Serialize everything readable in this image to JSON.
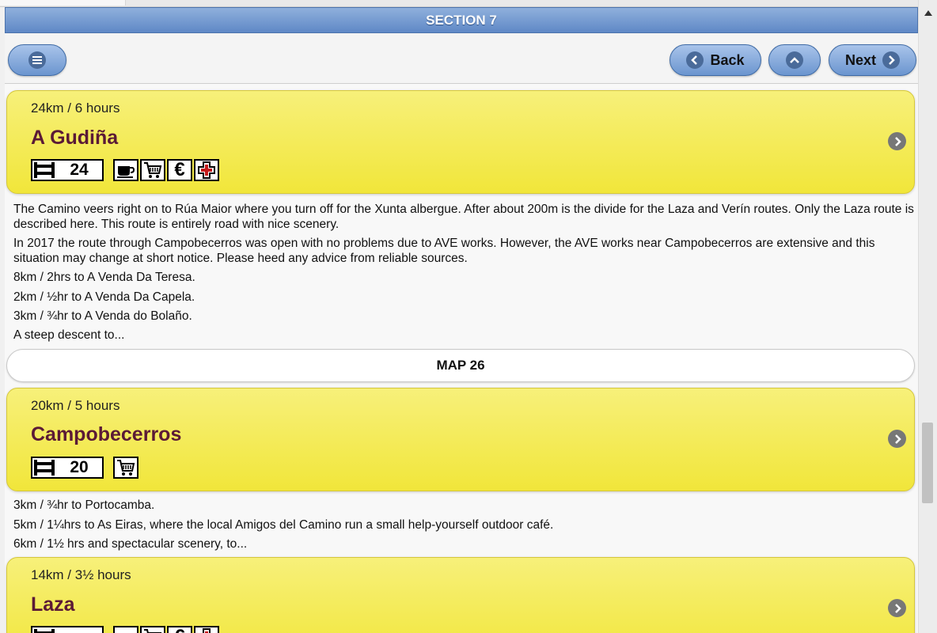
{
  "header": {
    "title": "SECTION 7"
  },
  "toolbar": {
    "back_label": "Back",
    "next_label": "Next"
  },
  "stages": [
    {
      "distance": "24km / 6 hours",
      "place": "A Gudiña",
      "beds": "24",
      "facilities": [
        "cafe-icon",
        "shop-cart-icon",
        "euro-icon",
        "medical-cross-icon"
      ]
    },
    {
      "distance": "20km / 5 hours",
      "place": "Campobecerros",
      "beds": "20",
      "facilities": [
        "shop-cart-icon"
      ]
    },
    {
      "distance": "14km / 3½ hours",
      "place": "Laza",
      "beds": "",
      "facilities": [
        "cafe-icon",
        "shop-cart-icon",
        "euro-icon",
        "medical-cross-icon"
      ]
    }
  ],
  "paragraphs1": [
    "The Camino veers right on to Rúa Maior where you turn off for the Xunta albergue. After about 200m is the divide for the Laza and Verín routes. Only the Laza route is described here. This route is entirely road with nice scenery.",
    "In 2017 the route through Campobecerros was open with no problems due to AVE works. However, the AVE works near Campobecerros are extensive and this situation may change at short notice. Please heed any advice from reliable sources.",
    "8km / 2hrs to A Venda Da Teresa.",
    "2km / ½hr to A Venda Da Capela.",
    "3km / ¾hr to A Venda do Bolaño.",
    "A steep descent to..."
  ],
  "map_label": "MAP 26",
  "paragraphs2": [
    "3km / ¾hr to Portocamba.",
    "5km / 1¼hrs to As Eiras, where the local Amigos del Camino run a small help-yourself outdoor café.",
    "6km / 1½ hrs and spectacular scenery, to..."
  ]
}
